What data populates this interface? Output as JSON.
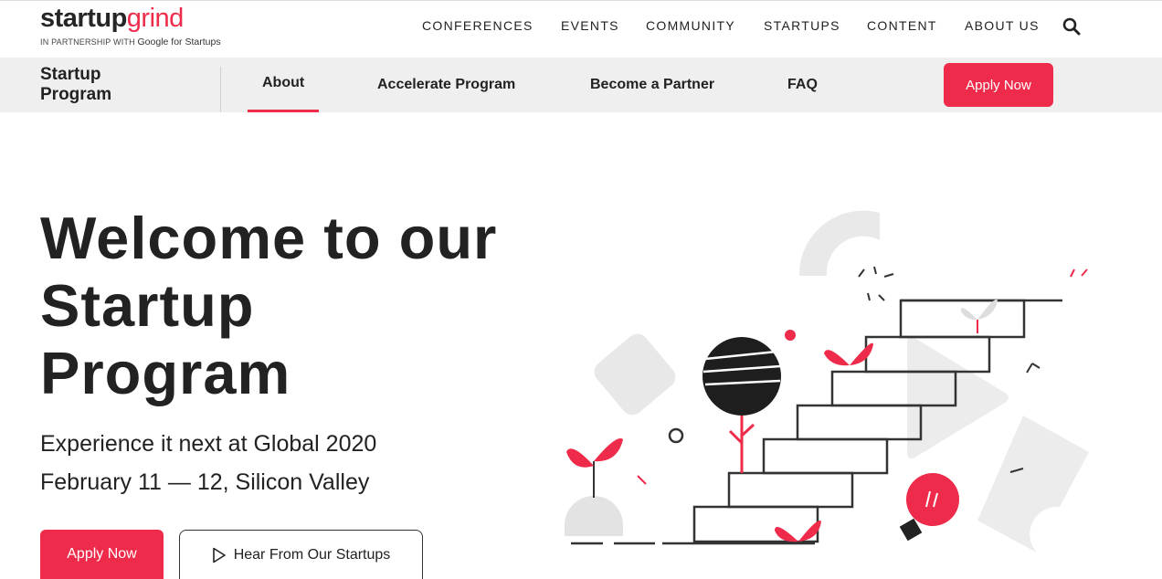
{
  "logo": {
    "brand_part1": "startup",
    "brand_part2": "grind",
    "partnership_text": "IN PARTNERSHIP WITH",
    "partner_name": "Google for Startups"
  },
  "top_nav": {
    "items": [
      "CONFERENCES",
      "EVENTS",
      "COMMUNITY",
      "STARTUPS",
      "CONTENT",
      "ABOUT US"
    ],
    "search_icon": "search-icon"
  },
  "sub_nav": {
    "title_line1": "Startup",
    "title_line2": "Program",
    "items": [
      "About",
      "Accelerate Program",
      "Become a Partner",
      "FAQ"
    ],
    "active_item": "About",
    "apply_label": "Apply Now"
  },
  "hero": {
    "title_line1": "Welcome to our",
    "title_line2": "Startup",
    "title_line3": "Program",
    "subtitle1": "Experience it next at Global 2020",
    "subtitle2": "February 11 — 12, Silicon Valley",
    "apply_label": "Apply Now",
    "hear_label": "Hear From Our Startups"
  },
  "colors": {
    "accent": "#ee2b4a",
    "subbar_bg": "#efefef",
    "text": "#222222"
  }
}
